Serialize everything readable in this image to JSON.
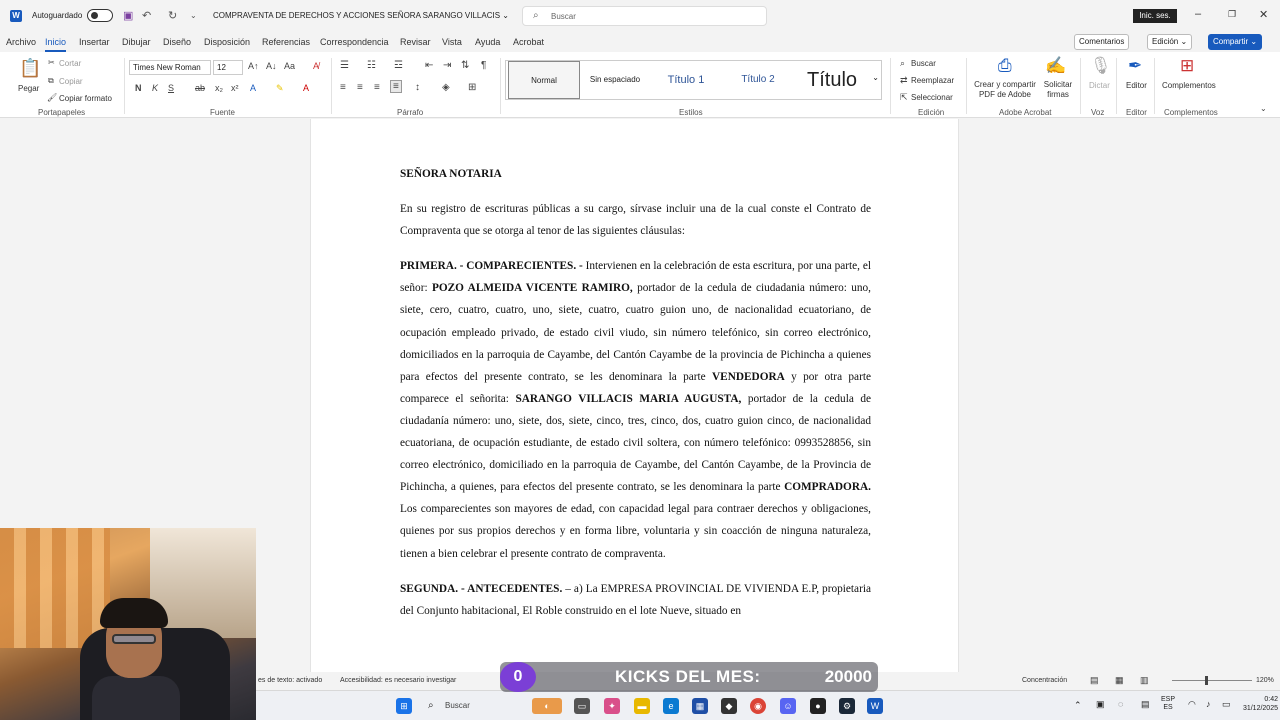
{
  "titlebar": {
    "autosave_label": "Autoguardado",
    "doc_title": "COMPRAVENTA DE DERECHOS Y ACCIONES SEÑORA SARANGO VILLACIS ⌄",
    "search_placeholder": "Buscar",
    "signin_label": "Inic. ses."
  },
  "menu": {
    "items": [
      "Archivo",
      "Inicio",
      "Insertar",
      "Dibujar",
      "Diseño",
      "Disposición",
      "Referencias",
      "Correspondencia",
      "Revisar",
      "Vista",
      "Ayuda",
      "Acrobat"
    ],
    "active": "Inicio",
    "comments_label": "Comentarios",
    "editing_label": "Edición ⌄",
    "share_label": "Compartir ⌄"
  },
  "ribbon": {
    "clipboard": {
      "paste": "Pegar",
      "cut": "Cortar",
      "copy": "Copiar",
      "format": "Copiar formato",
      "group": "Portapapeles"
    },
    "font": {
      "name": "Times New Roman",
      "size": "12",
      "group": "Fuente"
    },
    "paragraph": {
      "group": "Párrafo"
    },
    "styles": {
      "items": [
        "Normal",
        "Sin espaciado",
        "Título 1",
        "Título 2",
        "Título"
      ],
      "group": "Estilos"
    },
    "editing": {
      "find": "Buscar",
      "replace": "Reemplazar",
      "select": "Seleccionar",
      "group": "Edición"
    },
    "adobe": {
      "create": "Crear y compartir PDF de Adobe",
      "sign": "Solicitar firmas",
      "group": "Adobe Acrobat"
    },
    "voice": {
      "dictate": "Dictar",
      "group": "Voz"
    },
    "editor": {
      "label": "Editor",
      "group": "Editor"
    },
    "addins": {
      "label": "Complementos",
      "group": "Complementos"
    }
  },
  "document": {
    "heading": "SEÑORA NOTARIA",
    "intro": "En su registro de escrituras públicas a su cargo, sírvase incluir una de la cual conste el Contrato de Compraventa que se otorga al tenor de las siguientes cláusulas:",
    "p1_head": "PRIMERA. - COMPARECIENTES. -",
    "p1_a": " Intervienen en la celebración de esta escritura, por una parte, el señor: ",
    "p1_name1": "POZO ALMEIDA VICENTE RAMIRO,",
    "p1_b": " portador de la cedula de ciudadania número: uno, siete, cero, cuatro, cuatro, uno, siete, cuatro, cuatro guion uno, de nacionalidad ecuatoriano, de ocupación empleado privado, de estado civil viudo, sin número telefónico, sin correo electrónico, domiciliados en la parroquia de Cayambe, del Cantón Cayambe de la provincia de Pichincha a quienes para efectos del presente contrato, se les denominara la parte ",
    "p1_vend": "VENDEDORA",
    "p1_c": " y por otra parte comparece el señorita: ",
    "p1_name2": "SARANGO VILLACIS MARIA AUGUSTA,",
    "p1_d": " portador de la cedula de ciudadanía número: uno, siete, dos, siete, cinco, tres, cinco, dos, cuatro guion cinco, de nacionalidad ecuatoriana, de ocupación estudiante, de estado civil soltera, con número telefónico: 0993528856, sin correo electrónico, domiciliado en la parroquia de Cayambe, del Cantón Cayambe, de la Provincia de Pichincha, a quienes, para efectos del presente contrato, se les denominara la parte ",
    "p1_comp": "COMPRADORA.",
    "p1_e": " Los comparecientes son mayores de edad, con capacidad legal para contraer derechos y obligaciones, quienes por sus propios derechos y en forma libre, voluntaria y sin coacción de ninguna naturaleza, tienen a bien celebrar el presente contrato de compraventa.",
    "p2_head": "SEGUNDA. - ANTECEDENTES.",
    "p2_a": " – a) La EMPRESA PROVINCIAL DE VIVIENDA E.P, propietaria del Conjunto habitacional, El Roble construido en el lote Nueve, situado en"
  },
  "statusbar": {
    "left": "es de texto: activado",
    "accessibility": "Accesibilidad: es necesario investigar",
    "focus": "Concentración",
    "zoom": "120%"
  },
  "taskbar": {
    "search": "Buscar",
    "lang": "ESP",
    "region": "ES",
    "time": "0:42",
    "date": "31/12/2025"
  },
  "overlay": {
    "count": "0",
    "label": "KICKS DEL MES:",
    "goal": "20000"
  }
}
